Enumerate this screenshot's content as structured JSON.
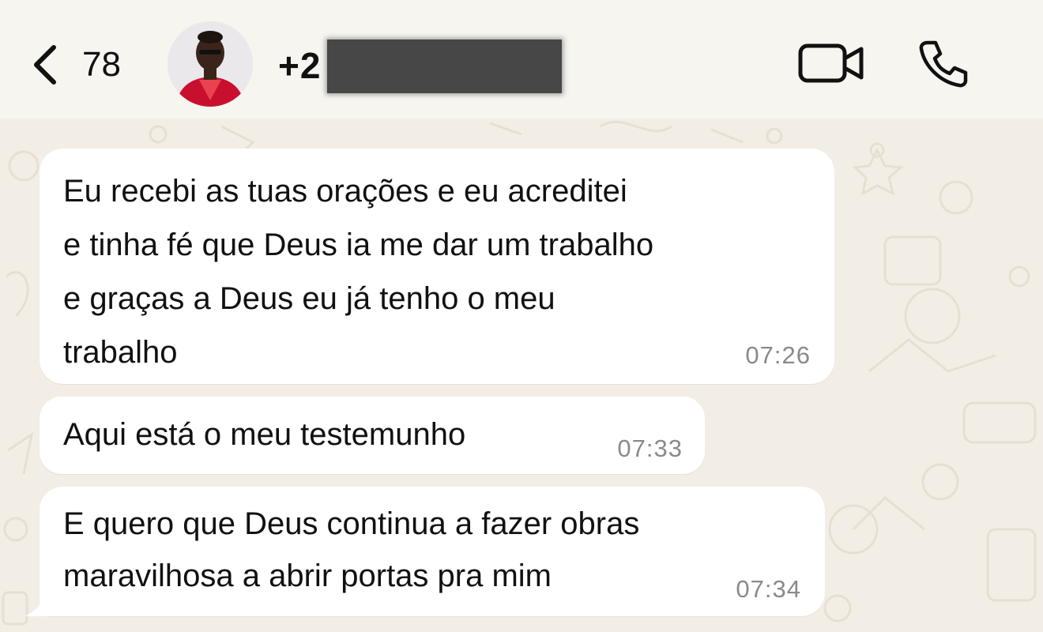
{
  "header": {
    "back_count": "78",
    "contact_number_visible": "+2",
    "icons": {
      "back": "chevron-left-icon",
      "video": "video-camera-icon",
      "call": "phone-icon"
    }
  },
  "messages": [
    {
      "text": "Eu recebi as tuas orações e eu  acreditei\ne tinha fé que Deus ia me dar um trabalho\ne graças a Deus eu já tenho o meu\ntrabalho",
      "time": "07:26"
    },
    {
      "text": "Aqui está o meu testemunho",
      "time": "07:33"
    },
    {
      "text": "E quero que Deus continua a fazer obras\nmaravilhosa a abrir portas pra mim",
      "time": "07:34"
    }
  ],
  "colors": {
    "bubble": "#ffffff",
    "wallpaper": "#f3eee5",
    "header": "#f6f5f0",
    "time": "#8a8a8a"
  }
}
